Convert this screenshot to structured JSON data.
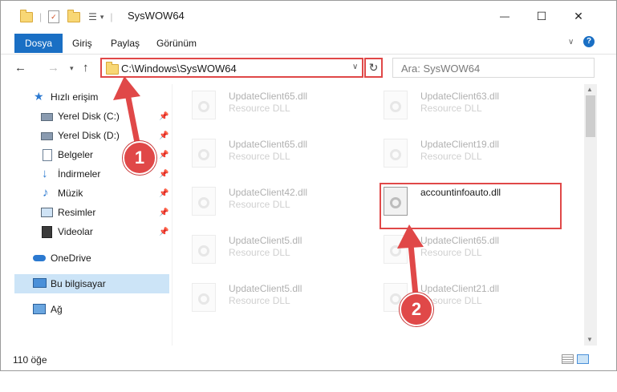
{
  "window": {
    "title": "SysWOW64",
    "controls": {
      "minimize": "—",
      "maximize": "☐",
      "close": "✕"
    }
  },
  "ribbon": {
    "tabs": [
      "Dosya",
      "Giriş",
      "Paylaş",
      "Görünüm"
    ]
  },
  "address": {
    "path": "C:\\Windows\\SysWOW64",
    "search_placeholder": "Ara: SysWOW64"
  },
  "nav": {
    "items": [
      {
        "label": "Hızlı erişim",
        "icon": "star-icon",
        "pinned": false
      },
      {
        "label": "Yerel Disk (C:)",
        "icon": "drive-icon",
        "pinned": true
      },
      {
        "label": "Yerel Disk (D:)",
        "icon": "drive-icon",
        "pinned": true
      },
      {
        "label": "Belgeler",
        "icon": "documents-icon",
        "pinned": true
      },
      {
        "label": "İndirmeler",
        "icon": "download-icon",
        "pinned": true
      },
      {
        "label": "Müzik",
        "icon": "music-icon",
        "pinned": true
      },
      {
        "label": "Resimler",
        "icon": "pictures-icon",
        "pinned": true
      },
      {
        "label": "Videolar",
        "icon": "video-icon",
        "pinned": true
      },
      {
        "label": "OneDrive",
        "icon": "cloud-icon",
        "pinned": false
      },
      {
        "label": "Bu bilgisayar",
        "icon": "computer-icon",
        "pinned": false
      },
      {
        "label": "Ağ",
        "icon": "network-icon",
        "pinned": false
      }
    ]
  },
  "files": [
    {
      "name": "UpdateClient65.dll",
      "type": "Resource DLL"
    },
    {
      "name": "UpdateClient63.dll",
      "type": "Resource DLL"
    },
    {
      "name": "UpdateClient65.dll",
      "type": "Resource DLL"
    },
    {
      "name": "UpdateClient19.dll",
      "type": "Resource DLL"
    },
    {
      "name": "UpdateClient42.dll",
      "type": "Resource DLL"
    },
    {
      "name": "accountinfoauto.dll",
      "type": ""
    },
    {
      "name": "UpdateClient5.dll",
      "type": "Resource DLL"
    },
    {
      "name": "UpdateClient65.dll",
      "type": "Resource DLL"
    },
    {
      "name": "UpdateClient5.dll",
      "type": "Resource DLL"
    },
    {
      "name": "UpdateClient21.dll",
      "type": "Resource DLL"
    }
  ],
  "status": {
    "count": "110 öğe"
  },
  "callouts": {
    "first": "1",
    "second": "2"
  },
  "colors": {
    "accent": "#1a6fc4",
    "highlight": "#e04848",
    "selection": "#cce4f7"
  }
}
